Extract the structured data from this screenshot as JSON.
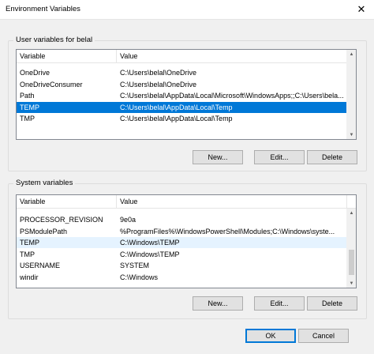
{
  "window": {
    "title": "Environment Variables",
    "close_glyph": "✕"
  },
  "user_vars": {
    "legend": "User variables for belal",
    "headers": {
      "variable": "Variable",
      "value": "Value"
    },
    "rows": [
      {
        "variable": "OneDrive",
        "value": "C:\\Users\\belal\\OneDrive"
      },
      {
        "variable": "OneDriveConsumer",
        "value": "C:\\Users\\belal\\OneDrive"
      },
      {
        "variable": "Path",
        "value": "C:\\Users\\belal\\AppData\\Local\\Microsoft\\WindowsApps;;C:\\Users\\bela..."
      },
      {
        "variable": "TEMP",
        "value": "C:\\Users\\belal\\AppData\\Local\\Temp"
      },
      {
        "variable": "TMP",
        "value": "C:\\Users\\belal\\AppData\\Local\\Temp"
      }
    ],
    "selected_row": 3,
    "buttons": {
      "new": "New...",
      "edit": "Edit...",
      "delete": "Delete"
    }
  },
  "system_vars": {
    "legend": "System variables",
    "headers": {
      "variable": "Variable",
      "value": "Value"
    },
    "rows": [
      {
        "variable": "PROCESSOR_REVISION",
        "value": "9e0a"
      },
      {
        "variable": "PSModulePath",
        "value": "%ProgramFiles%\\WindowsPowerShell\\Modules;C:\\Windows\\syste..."
      },
      {
        "variable": "TEMP",
        "value": "C:\\Windows\\TEMP"
      },
      {
        "variable": "TMP",
        "value": "C:\\Windows\\TEMP"
      },
      {
        "variable": "USERNAME",
        "value": "SYSTEM"
      },
      {
        "variable": "windir",
        "value": "C:\\Windows"
      }
    ],
    "hover_row": 2,
    "buttons": {
      "new": "New...",
      "edit": "Edit...",
      "delete": "Delete"
    }
  },
  "footer": {
    "ok": "OK",
    "cancel": "Cancel"
  },
  "colors": {
    "selection": "#0078d7",
    "hover": "#e5f3ff",
    "default_button_border": "#0078d7"
  },
  "icons": {
    "scroll_up": "scroll-up-arrow-icon",
    "scroll_down": "scroll-down-arrow-icon",
    "close": "close-icon"
  }
}
